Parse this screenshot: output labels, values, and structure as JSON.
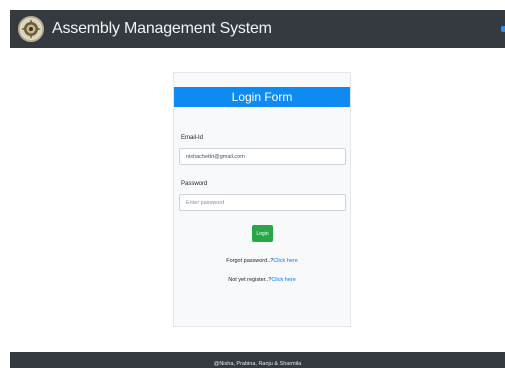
{
  "header": {
    "brand": "Assembly Management System",
    "logo_icon": "emblem-logo-icon"
  },
  "login_form": {
    "title": "Login Form",
    "email_label": "Email-Id",
    "email_value": "nishachettri@gmail.com",
    "password_label": "Password",
    "password_placeholder": "Enter password",
    "login_button": "Login",
    "forgot_text": "Forgot password..?",
    "forgot_link": "Click here",
    "register_text": "Not yet register..?",
    "register_link": "Click here"
  },
  "footer": {
    "text": "@Nisha, Prabina, Ranju & Sharmila"
  },
  "colors": {
    "navbar": "#343a40",
    "header_accent": "#0d8bf2",
    "button": "#28a745",
    "link": "#007bff",
    "card_bg": "#f8f9fa"
  }
}
